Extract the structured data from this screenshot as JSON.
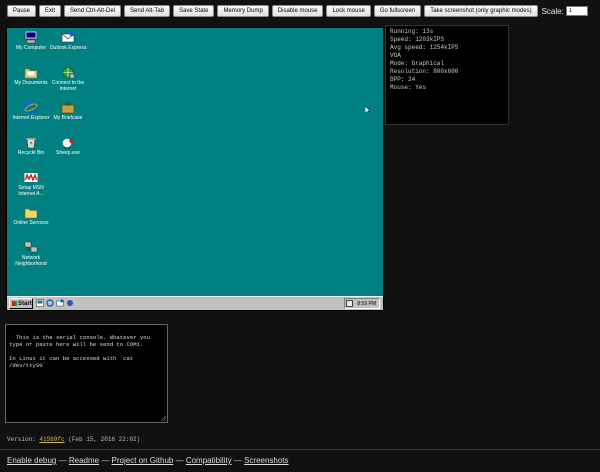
{
  "toolbar": {
    "buttons": [
      "Pause",
      "Exit",
      "Send Ctrl-Alt-Del",
      "Send Alt-Tab",
      "Save State",
      "Memory Dump",
      "Disable mouse",
      "Lock mouse",
      "Go fullscreen",
      "Take screenshot (only graphic modes)"
    ],
    "scale_label": "Scale:",
    "scale_value": "1"
  },
  "desktop": {
    "background_color": "#008080",
    "icons": [
      {
        "label": "My Computer",
        "icon": "computer-icon"
      },
      {
        "label": "Outlook Express",
        "icon": "mail-icon"
      },
      {
        "label": "My Documents",
        "icon": "folder-icon"
      },
      {
        "label": "Connect to the Internet",
        "icon": "connect-icon"
      },
      {
        "label": "Internet Explorer",
        "icon": "ie-icon"
      },
      {
        "label": "My Briefcase",
        "icon": "briefcase-icon"
      },
      {
        "label": "Recycle Bin",
        "icon": "recycle-bin-icon"
      },
      {
        "label": "Sheep.exe",
        "icon": "sheep-icon"
      },
      {
        "label": "Setup MSN Internet A...",
        "icon": "msn-icon"
      },
      {
        "label": "Online Services",
        "icon": "folder-icon"
      },
      {
        "label": "Network Neighborhood",
        "icon": "network-icon"
      }
    ],
    "taskbar": {
      "start_label": "Start",
      "clock": "8:59 PM"
    }
  },
  "info_panel": {
    "lines": [
      "Running: 13s",
      "Speed: 1203kIPS",
      "Avg speed: 1254kIPS",
      "",
      "VGA",
      "Mode: Graphical",
      "Resolution: 800x600",
      "BPP: 24",
      "",
      "Mouse: Yes"
    ]
  },
  "serial_console": {
    "text": "This is the serial console. Whatever you type or paste here will be send to COM1.\n\nIn Linux it can be accessed with `cat /dev/ttyS0`"
  },
  "version": {
    "prefix": "Version: ",
    "hash": "415b9fc",
    "date": " (Feb 15, 2016 22:02)"
  },
  "footer": {
    "links": [
      "Enable debug",
      "Readme",
      "Project on Github",
      "Compatibility",
      "Screenshots"
    ],
    "separator": " — "
  },
  "colors": {
    "page_background": "#111111",
    "link_version_hash": "#d4b45a"
  }
}
